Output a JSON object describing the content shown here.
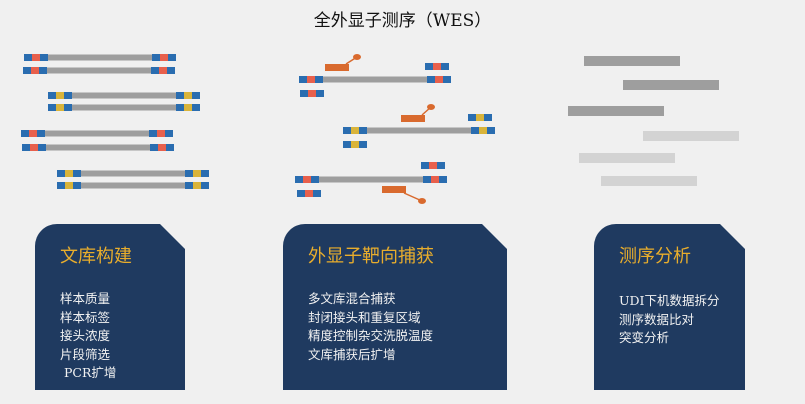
{
  "title": "全外显子测序（WES）",
  "colors": {
    "adapter": "#2a6db0",
    "index_red": "#e8604c",
    "index_yellow": "#d9b43a",
    "insert": "#9e9e9e",
    "insert_light": "#d3d3d3",
    "probe": "#d96a2e",
    "box": "#1f3a60",
    "heading": "#e8ad2c"
  },
  "steps": [
    {
      "heading": "文库构建",
      "items": [
        "样本质量",
        "样本标签",
        "接头浓度",
        "片段筛选",
        " PCR扩增"
      ]
    },
    {
      "heading": "外显子靶向捕获",
      "items": [
        "多文库混合捕获",
        "封闭接头和重复区域",
        "精度控制杂交洗脱温度",
        "文库捕获后扩增"
      ]
    },
    {
      "heading": "测序分析",
      "items": [
        "UDI下机数据拆分",
        "测序数据比对",
        "突变分析"
      ]
    }
  ]
}
